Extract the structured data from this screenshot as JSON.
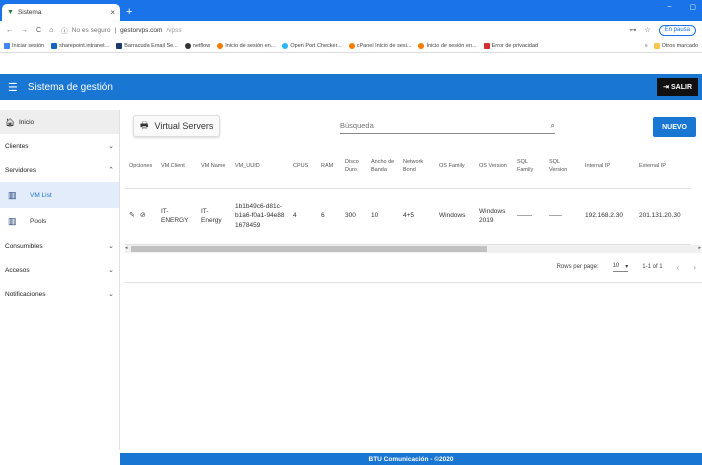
{
  "browser": {
    "tab_title": "Sistema",
    "new_tab": "+",
    "url_insecure": "No es seguro",
    "url_domain": "gestorvps.com",
    "url_path": "/vpss",
    "pause_label": "En pausa",
    "bookmarks": [
      {
        "label": "Iniciar sesión",
        "color": "#4285f4"
      },
      {
        "label": "sharepoint.intranet...",
        "color": "#1565c0"
      },
      {
        "label": "Barracuda Email Se...",
        "color": "#1a3a6c"
      },
      {
        "label": "netflow",
        "color": "#333333"
      },
      {
        "label": "Inicio de sesión en...",
        "color": "#f57c00"
      },
      {
        "label": "Open Port Checker...",
        "color": "#29b6f6"
      },
      {
        "label": "cPanel Inicio de sesi...",
        "color": "#f57c00"
      },
      {
        "label": "Inicio de sesión en...",
        "color": "#f57c00"
      },
      {
        "label": "Error de privacidad",
        "color": "#d32f2f"
      }
    ],
    "other_bookmarks": "Otros marcado"
  },
  "app": {
    "title": "Sistema de gestión",
    "logout_label": "SALIR",
    "colors": {
      "primary": "#1976d2",
      "logout": "#111111"
    }
  },
  "sidebar": {
    "home": "Inicio",
    "clientes": "Clientes",
    "servidores": "Servidores",
    "vm_list": "VM List",
    "pools": "Pools",
    "consumibles": "Consumibles",
    "accesos": "Accesos",
    "notificaciones": "Notificaciones"
  },
  "main": {
    "section_title": "Virtual Servers",
    "search_placeholder": "Búsqueda",
    "new_button": "NUEVO",
    "columns": [
      "Opciones",
      "VM Client",
      "VM Name",
      "VM_UUID",
      "CPUS",
      "RAM",
      "Disco Duro",
      "Ancho de Banda",
      "Network Bond",
      "OS Family",
      "OS Version",
      "SQL Family",
      "SQL Version",
      "Internal IP",
      "External IP"
    ],
    "rows": [
      {
        "vm_client": "IT-ENERGY",
        "vm_name": "IT-Energy",
        "vm_uuid": "1b1b49c6-d81c-b1a6-f0a1-94e881678459",
        "cpus": "4",
        "ram": "6",
        "disco": "300",
        "ancho": "10",
        "bond": "4+5",
        "os_family": "Windows",
        "os_version": "Windows 2019",
        "sql_family": "——-",
        "sql_version": "——",
        "internal_ip": "192.168.2.30",
        "external_ip": "201.131.20.30"
      }
    ],
    "rows_per_page_label": "Rows per page:",
    "rows_per_page_value": "10",
    "page_range": "1-1 of 1"
  },
  "footer": {
    "text": "BTU Comunicación - ©2020"
  }
}
